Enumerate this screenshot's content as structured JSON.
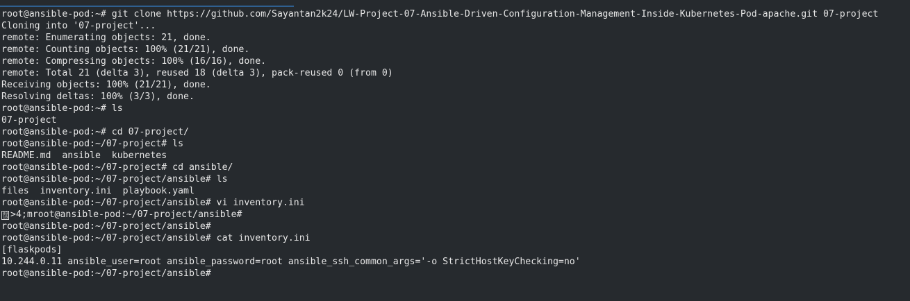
{
  "terminal": {
    "lines": [
      "root@ansible-pod:~# git clone https://github.com/Sayantan2k24/LW-Project-07-Ansible-Driven-Configuration-Management-Inside-Kubernetes-Pod-apache.git 07-project",
      "Cloning into '07-project'...",
      "remote: Enumerating objects: 21, done.",
      "remote: Counting objects: 100% (21/21), done.",
      "remote: Compressing objects: 100% (16/16), done.",
      "remote: Total 21 (delta 3), reused 18 (delta 3), pack-reused 0 (from 0)",
      "Receiving objects: 100% (21/21), done.",
      "Resolving deltas: 100% (3/3), done.",
      "root@ansible-pod:~# ls",
      "07-project",
      "root@ansible-pod:~# cd 07-project/",
      "root@ansible-pod:~/07-project# ls",
      "README.md  ansible  kubernetes",
      "root@ansible-pod:~/07-project# cd ansible/",
      "root@ansible-pod:~/07-project/ansible# ls",
      "files  inventory.ini  playbook.yaml",
      "root@ansible-pod:~/07-project/ansible# vi inventory.ini",
      ">4;mroot@ansible-pod:~/07-project/ansible#",
      "root@ansible-pod:~/07-project/ansible#",
      "root@ansible-pod:~/07-project/ansible# cat inventory.ini",
      "[flaskpods]",
      "10.244.0.11 ansible_user=root ansible_password=root ansible_ssh_common_args='-o StrictHostKeyChecking=no'",
      "root@ansible-pod:~/07-project/ansible#"
    ],
    "control_glyph": "001B"
  },
  "colors": {
    "background": "#262a2e",
    "foreground": "#e6e6e6",
    "tab_indicator": "#2f5f8f"
  }
}
